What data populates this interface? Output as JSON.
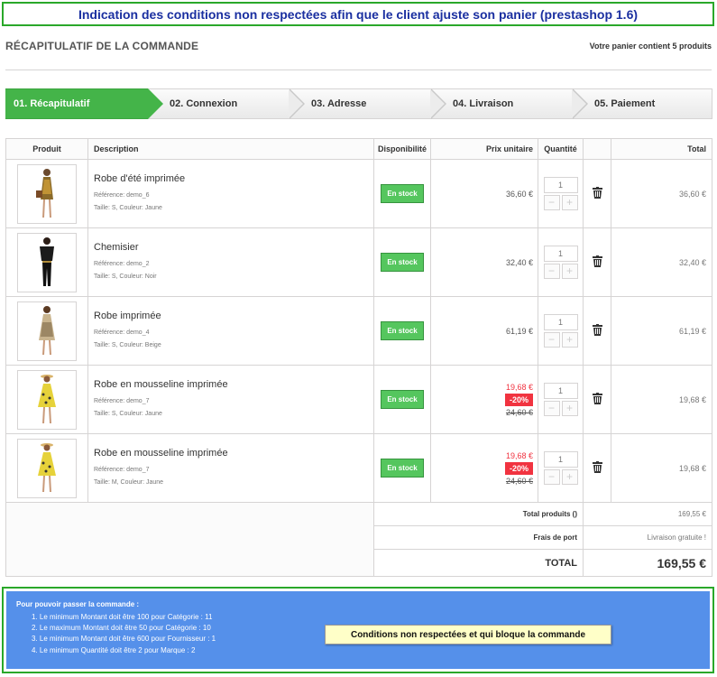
{
  "banner": "Indication des conditions non respectées afin que le client ajuste son panier (prestashop 1.6)",
  "heading": "RÉCAPITULATIF DE LA COMMANDE",
  "cart_count": "Votre panier contient 5 produits",
  "steps": [
    {
      "label": "01. Récapitulatif",
      "active": true
    },
    {
      "label": "02. Connexion",
      "active": false
    },
    {
      "label": "03. Adresse",
      "active": false
    },
    {
      "label": "04. Livraison",
      "active": false
    },
    {
      "label": "05. Paiement",
      "active": false
    }
  ],
  "table": {
    "headers": {
      "product": "Produit",
      "description": "Description",
      "availability": "Disponibilité",
      "unit_price": "Prix unitaire",
      "quantity": "Quantité",
      "total": "Total"
    },
    "rows": [
      {
        "name": "Robe d'été imprimée",
        "reference": "Référence: demo_6",
        "attributes": "Taille: S, Couleur: Jaune",
        "stock": "En stock",
        "price": "36,60 €",
        "qty": "1",
        "total": "36,60 €"
      },
      {
        "name": "Chemisier",
        "reference": "Référence: demo_2",
        "attributes": "Taille: S, Couleur: Noir",
        "stock": "En stock",
        "price": "32,40 €",
        "qty": "1",
        "total": "32,40 €"
      },
      {
        "name": "Robe imprimée",
        "reference": "Référence: demo_4",
        "attributes": "Taille: S, Couleur: Beige",
        "stock": "En stock",
        "price": "61,19 €",
        "qty": "1",
        "total": "61,19 €"
      },
      {
        "name": "Robe en mousseline imprimée",
        "reference": "Référence: demo_7",
        "attributes": "Taille: S, Couleur: Jaune",
        "stock": "En stock",
        "price": "19,68 €",
        "reduction": "-20%",
        "old_price": "24,60 €",
        "qty": "1",
        "total": "19,68 €"
      },
      {
        "name": "Robe en mousseline imprimée",
        "reference": "Référence: demo_7",
        "attributes": "Taille: M, Couleur: Jaune",
        "stock": "En stock",
        "price": "19,68 €",
        "reduction": "-20%",
        "old_price": "24,60 €",
        "qty": "1",
        "total": "19,68 €"
      }
    ],
    "summary": {
      "products_label": "Total produits ()",
      "products_value": "169,55 €",
      "shipping_label": "Frais de port",
      "shipping_value": "Livraison gratuite !",
      "total_label": "TOTAL",
      "total_value": "169,55 €"
    }
  },
  "conditions": {
    "title": "Pour pouvoir passer la commande :",
    "items": [
      "1. Le minimum Montant doit être 100 pour Catégorie : 11",
      "2. Le maximum Montant doit être 50 pour Catégorie : 10",
      "3. Le minimum Montant doit être 600 pour Fournisseur : 1",
      "4. Le minimum Quantité doit être 2 pour Marque : 2"
    ],
    "note": "Conditions non respectées et qui bloque la commande"
  },
  "colors": {
    "accent_green": "#44b449",
    "stock_green": "#55c65e",
    "discount_red": "#f13340",
    "conditions_blue": "#5590ea",
    "banner_text": "#1a2fa0"
  }
}
